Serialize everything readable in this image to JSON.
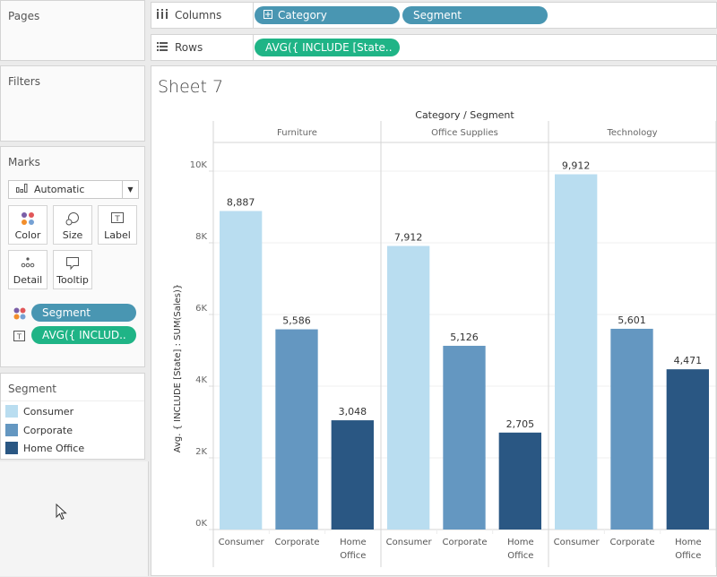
{
  "panels": {
    "pages": "Pages",
    "filters": "Filters",
    "marks": "Marks"
  },
  "shelves": {
    "columns_label": "Columns",
    "rows_label": "Rows",
    "columns_pills": [
      "Category",
      "Segment"
    ],
    "rows_pills": [
      "AVG({ INCLUDE [State.."
    ]
  },
  "marks": {
    "type": "Automatic",
    "buttons": [
      "Color",
      "Size",
      "Label",
      "Detail",
      "Tooltip"
    ],
    "pills": [
      {
        "label": "Segment",
        "kind": "color"
      },
      {
        "label": "AVG({ INCLUD..",
        "kind": "label"
      }
    ]
  },
  "legend": {
    "title": "Segment",
    "items": [
      {
        "label": "Consumer",
        "color": "#b9ddf0"
      },
      {
        "label": "Corporate",
        "color": "#6497c1"
      },
      {
        "label": "Home Office",
        "color": "#2a5783"
      }
    ]
  },
  "sheet_title": "Sheet 7",
  "chart_data": {
    "type": "bar",
    "title": "Category / Segment",
    "xlabel": "",
    "ylabel": "Avg. { INCLUDE [State] : SUM(Sales)}",
    "ylim": [
      0,
      10000
    ],
    "yticks": [
      0,
      2000,
      4000,
      6000,
      8000,
      10000
    ],
    "ytick_labels": [
      "0K",
      "2K",
      "4K",
      "6K",
      "8K",
      "10K"
    ],
    "grid": true,
    "categories": [
      "Furniture",
      "Office Supplies",
      "Technology"
    ],
    "segments": [
      "Consumer",
      "Corporate",
      "Home Office"
    ],
    "segment_labels": [
      [
        "Consumer"
      ],
      [
        "Corporate"
      ],
      [
        "Home",
        "Office"
      ]
    ],
    "series": [
      {
        "name": "Consumer",
        "color": "#b9ddf0",
        "values": [
          8887,
          7912,
          9912
        ],
        "labels": [
          "8,887",
          "7,912",
          "9,912"
        ]
      },
      {
        "name": "Corporate",
        "color": "#6497c1",
        "values": [
          5586,
          5126,
          5601
        ],
        "labels": [
          "5,586",
          "5,126",
          "5,601"
        ]
      },
      {
        "name": "Home Office",
        "color": "#2a5783",
        "values": [
          3048,
          2705,
          4471
        ],
        "labels": [
          "3,048",
          "2,705",
          "4,471"
        ]
      }
    ]
  }
}
